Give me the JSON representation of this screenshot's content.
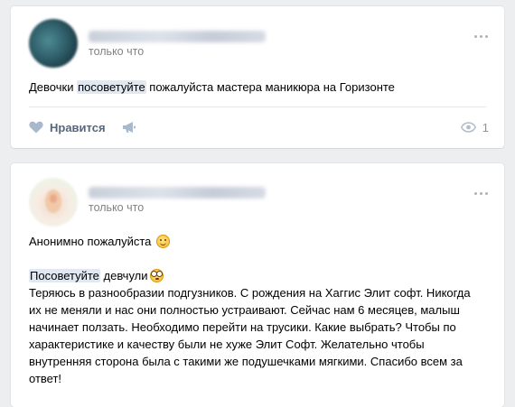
{
  "posts": [
    {
      "time": "только что",
      "text_parts": {
        "before": "Девочки ",
        "highlight": "посоветуйте",
        "after": " пожалуйста мастера маникюра на Горизонте"
      },
      "actions": {
        "like_label": "Нравится",
        "views_count": "1"
      }
    },
    {
      "time": "только что",
      "line1": "Анонимно пожалуйста ",
      "line2_highlight": "Посоветуйте",
      "line2_after": " девчули",
      "paragraph": "Теряюсь в разнообразии подгузников. С рождения на Хаггис Элит софт. Никогда их не меняли и нас они полностью устраивают. Сейчас нам 6 месяцев, малыш начинает ползать. Необходимо перейти на трусики. Какие выбрать? Чтобы по характеристике и качеству были не хуже Элит Софт. Желательно чтобы внутренняя сторона была с такими же подушечками мягкими. Спасибо всем за ответ!"
    }
  ],
  "icons": {
    "like": "heart-icon",
    "share": "megaphone-icon",
    "views": "eye-icon",
    "more": "more-dots-icon",
    "emoji1": "smiling-face-icon",
    "emoji2": "flushed-face-icon"
  },
  "colors": {
    "background": "#edeef0",
    "card": "#ffffff",
    "highlight": "#e1e8f2",
    "action_text": "#55677d",
    "meta_text": "#828282"
  }
}
